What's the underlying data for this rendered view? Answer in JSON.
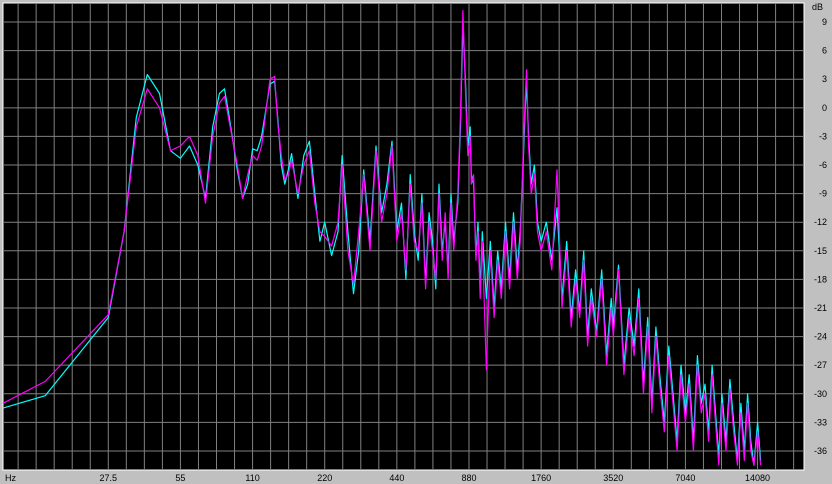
{
  "chart_data": {
    "type": "line",
    "xscale": "log",
    "x_unit": "Hz",
    "y_unit": "dB",
    "xlim": [
      10,
      22000
    ],
    "ylim": [
      -38,
      11
    ],
    "xticks": [
      27.5,
      55,
      110,
      220,
      440,
      880,
      1760,
      3520,
      7040,
      14080
    ],
    "xtick_labels": [
      "27.5",
      "55",
      "110",
      "220",
      "440",
      "880",
      "1760",
      "3520",
      "7040",
      "14080"
    ],
    "yticks": [
      9,
      6,
      3,
      0,
      -3,
      -6,
      -9,
      -12,
      -15,
      -18,
      -21,
      -24,
      -27,
      -30,
      -33,
      -36
    ],
    "ytick_labels": [
      "9",
      "6",
      "3",
      "0",
      "-3",
      "-6",
      "-9",
      "-12",
      "-15",
      "-18",
      "-21",
      "-24",
      "-27",
      "-30",
      "-33",
      "-36"
    ],
    "grid": true,
    "colors": {
      "background": "#000000",
      "grid": "#808080",
      "frame": "#c0c0c0"
    },
    "series": [
      {
        "color": "#00ffff",
        "points": [
          [
            10,
            -31.5
          ],
          [
            15,
            -30.2
          ],
          [
            27.5,
            -22
          ],
          [
            32,
            -13
          ],
          [
            36,
            -1
          ],
          [
            40,
            3.5
          ],
          [
            45,
            1.5
          ],
          [
            50,
            -4.5
          ],
          [
            55,
            -5.3
          ],
          [
            60,
            -4
          ],
          [
            65,
            -6
          ],
          [
            70,
            -9.5
          ],
          [
            75,
            -2
          ],
          [
            80,
            1.5
          ],
          [
            84,
            2
          ],
          [
            88,
            -1
          ],
          [
            95,
            -6.5
          ],
          [
            100,
            -9.5
          ],
          [
            105,
            -8
          ],
          [
            110,
            -4.3
          ],
          [
            115,
            -4.5
          ],
          [
            120,
            -3
          ],
          [
            130,
            2.5
          ],
          [
            136,
            2.8
          ],
          [
            140,
            -1
          ],
          [
            145,
            -6
          ],
          [
            150,
            -8
          ],
          [
            155,
            -6.5
          ],
          [
            160,
            -4.8
          ],
          [
            170,
            -9.5
          ],
          [
            180,
            -5
          ],
          [
            190,
            -3.5
          ],
          [
            200,
            -9
          ],
          [
            210,
            -14
          ],
          [
            220,
            -12
          ],
          [
            235,
            -15.5
          ],
          [
            250,
            -13
          ],
          [
            260,
            -5
          ],
          [
            275,
            -13
          ],
          [
            290,
            -19.5
          ],
          [
            305,
            -15
          ],
          [
            320,
            -6.5
          ],
          [
            340,
            -14
          ],
          [
            360,
            -4
          ],
          [
            380,
            -11
          ],
          [
            400,
            -8
          ],
          [
            420,
            -3.5
          ],
          [
            440,
            -13
          ],
          [
            460,
            -10
          ],
          [
            480,
            -18
          ],
          [
            500,
            -7
          ],
          [
            520,
            -13
          ],
          [
            540,
            -16
          ],
          [
            560,
            -9
          ],
          [
            580,
            -18.5
          ],
          [
            600,
            -11
          ],
          [
            620,
            -14
          ],
          [
            640,
            -19
          ],
          [
            660,
            -8
          ],
          [
            680,
            -15
          ],
          [
            700,
            -12
          ],
          [
            720,
            -17
          ],
          [
            740,
            -9
          ],
          [
            760,
            -14
          ],
          [
            790,
            -10
          ],
          [
            810,
            -2
          ],
          [
            830,
            8.8
          ],
          [
            850,
            3
          ],
          [
            870,
            -4
          ],
          [
            890,
            -2
          ],
          [
            900,
            -7
          ],
          [
            920,
            -8
          ],
          [
            940,
            -15.5
          ],
          [
            960,
            -12
          ],
          [
            980,
            -19
          ],
          [
            1000,
            -13
          ],
          [
            1040,
            -20
          ],
          [
            1080,
            -14
          ],
          [
            1120,
            -21
          ],
          [
            1160,
            -15
          ],
          [
            1200,
            -19
          ],
          [
            1250,
            -12
          ],
          [
            1300,
            -18
          ],
          [
            1350,
            -11
          ],
          [
            1400,
            -17
          ],
          [
            1440,
            -13
          ],
          [
            1480,
            -6
          ],
          [
            1510,
            0
          ],
          [
            1530,
            2.5
          ],
          [
            1560,
            -3
          ],
          [
            1600,
            -8
          ],
          [
            1650,
            -6
          ],
          [
            1700,
            -12
          ],
          [
            1760,
            -14
          ],
          [
            1850,
            -12
          ],
          [
            1950,
            -16
          ],
          [
            2050,
            -10.5
          ],
          [
            2150,
            -20
          ],
          [
            2250,
            -14
          ],
          [
            2350,
            -22
          ],
          [
            2450,
            -17
          ],
          [
            2550,
            -21.5
          ],
          [
            2650,
            -15
          ],
          [
            2750,
            -24
          ],
          [
            2850,
            -19
          ],
          [
            3000,
            -23.5
          ],
          [
            3150,
            -17
          ],
          [
            3300,
            -26
          ],
          [
            3450,
            -20
          ],
          [
            3520,
            -23
          ],
          [
            3700,
            -16.5
          ],
          [
            3900,
            -27
          ],
          [
            4100,
            -21
          ],
          [
            4300,
            -25
          ],
          [
            4500,
            -19
          ],
          [
            4700,
            -29
          ],
          [
            4900,
            -22
          ],
          [
            5100,
            -31
          ],
          [
            5300,
            -23
          ],
          [
            5500,
            -28
          ],
          [
            5750,
            -33
          ],
          [
            6000,
            -25
          ],
          [
            6250,
            -30
          ],
          [
            6500,
            -35
          ],
          [
            6750,
            -27
          ],
          [
            7040,
            -32
          ],
          [
            7300,
            -28
          ],
          [
            7600,
            -35
          ],
          [
            7900,
            -26
          ],
          [
            8200,
            -31
          ],
          [
            8500,
            -29
          ],
          [
            8800,
            -34
          ],
          [
            9100,
            -27
          ],
          [
            9400,
            -32
          ],
          [
            9700,
            -36.5
          ],
          [
            10000,
            -30
          ],
          [
            10400,
            -35
          ],
          [
            10800,
            -28.5
          ],
          [
            11200,
            -33
          ],
          [
            11600,
            -37
          ],
          [
            12000,
            -31
          ],
          [
            12400,
            -36
          ],
          [
            12800,
            -30
          ],
          [
            13200,
            -35
          ],
          [
            13600,
            -37.5
          ],
          [
            14080,
            -33
          ],
          [
            14500,
            -37
          ]
        ]
      },
      {
        "color": "#ff00ff",
        "points": [
          [
            10,
            -31
          ],
          [
            15,
            -28.7
          ],
          [
            27.5,
            -21.7
          ],
          [
            32,
            -13
          ],
          [
            36,
            -2
          ],
          [
            40,
            2
          ],
          [
            45,
            0
          ],
          [
            50,
            -4.5
          ],
          [
            55,
            -4
          ],
          [
            60,
            -3
          ],
          [
            65,
            -5
          ],
          [
            70,
            -10
          ],
          [
            75,
            -3
          ],
          [
            80,
            0.5
          ],
          [
            84,
            1.2
          ],
          [
            88,
            -1.5
          ],
          [
            95,
            -6
          ],
          [
            100,
            -9.5
          ],
          [
            105,
            -7
          ],
          [
            110,
            -5
          ],
          [
            115,
            -5.5
          ],
          [
            120,
            -4
          ],
          [
            130,
            3
          ],
          [
            136,
            3.3
          ],
          [
            140,
            -1.5
          ],
          [
            145,
            -5
          ],
          [
            150,
            -7.5
          ],
          [
            155,
            -7
          ],
          [
            160,
            -5.5
          ],
          [
            170,
            -9
          ],
          [
            180,
            -6
          ],
          [
            190,
            -4.5
          ],
          [
            200,
            -10
          ],
          [
            210,
            -13
          ],
          [
            220,
            -13.5
          ],
          [
            235,
            -14.5
          ],
          [
            250,
            -12
          ],
          [
            260,
            -6
          ],
          [
            275,
            -15
          ],
          [
            290,
            -18.5
          ],
          [
            305,
            -13
          ],
          [
            320,
            -7
          ],
          [
            340,
            -15
          ],
          [
            360,
            -4.5
          ],
          [
            380,
            -12
          ],
          [
            400,
            -9
          ],
          [
            420,
            -4
          ],
          [
            440,
            -14
          ],
          [
            460,
            -11
          ],
          [
            480,
            -17
          ],
          [
            500,
            -8
          ],
          [
            520,
            -14
          ],
          [
            540,
            -15
          ],
          [
            560,
            -10
          ],
          [
            580,
            -19
          ],
          [
            600,
            -12
          ],
          [
            620,
            -15
          ],
          [
            640,
            -18
          ],
          [
            660,
            -9
          ],
          [
            680,
            -16
          ],
          [
            700,
            -11
          ],
          [
            720,
            -18
          ],
          [
            740,
            -10
          ],
          [
            760,
            -15
          ],
          [
            790,
            -9
          ],
          [
            810,
            -1
          ],
          [
            830,
            10.2
          ],
          [
            850,
            2
          ],
          [
            870,
            -5
          ],
          [
            890,
            -3
          ],
          [
            900,
            -8
          ],
          [
            920,
            -7
          ],
          [
            940,
            -16
          ],
          [
            960,
            -13
          ],
          [
            980,
            -20
          ],
          [
            1000,
            -14
          ],
          [
            1040,
            -27.5
          ],
          [
            1080,
            -15
          ],
          [
            1120,
            -22
          ],
          [
            1160,
            -16
          ],
          [
            1200,
            -20
          ],
          [
            1250,
            -13
          ],
          [
            1300,
            -19
          ],
          [
            1350,
            -12
          ],
          [
            1400,
            -18
          ],
          [
            1440,
            -14
          ],
          [
            1480,
            -5
          ],
          [
            1510,
            1
          ],
          [
            1530,
            4
          ],
          [
            1560,
            -4
          ],
          [
            1600,
            -9
          ],
          [
            1650,
            -7
          ],
          [
            1700,
            -13
          ],
          [
            1760,
            -15
          ],
          [
            1850,
            -13
          ],
          [
            1950,
            -17
          ],
          [
            2050,
            -6.5
          ],
          [
            2150,
            -21
          ],
          [
            2250,
            -15
          ],
          [
            2350,
            -23
          ],
          [
            2450,
            -18
          ],
          [
            2550,
            -22
          ],
          [
            2650,
            -16
          ],
          [
            2750,
            -25
          ],
          [
            2850,
            -20
          ],
          [
            3000,
            -24
          ],
          [
            3150,
            -18
          ],
          [
            3300,
            -27
          ],
          [
            3450,
            -21
          ],
          [
            3520,
            -24
          ],
          [
            3700,
            -17
          ],
          [
            3900,
            -28
          ],
          [
            4100,
            -22
          ],
          [
            4300,
            -26
          ],
          [
            4500,
            -20
          ],
          [
            4700,
            -30
          ],
          [
            4900,
            -23
          ],
          [
            5100,
            -32
          ],
          [
            5300,
            -24
          ],
          [
            5500,
            -29
          ],
          [
            5750,
            -34
          ],
          [
            6000,
            -26
          ],
          [
            6250,
            -31
          ],
          [
            6500,
            -36
          ],
          [
            6750,
            -28
          ],
          [
            7040,
            -33
          ],
          [
            7300,
            -29
          ],
          [
            7600,
            -36
          ],
          [
            7900,
            -27
          ],
          [
            8200,
            -32
          ],
          [
            8500,
            -30
          ],
          [
            8800,
            -35
          ],
          [
            9100,
            -28
          ],
          [
            9400,
            -33
          ],
          [
            9700,
            -37.5
          ],
          [
            10000,
            -31
          ],
          [
            10400,
            -36
          ],
          [
            10800,
            -29.5
          ],
          [
            11200,
            -34
          ],
          [
            11600,
            -37.5
          ],
          [
            12000,
            -32
          ],
          [
            12400,
            -37
          ],
          [
            12800,
            -31
          ],
          [
            13200,
            -36
          ],
          [
            13600,
            -37.5
          ],
          [
            14080,
            -34
          ],
          [
            14500,
            -37.5
          ]
        ]
      }
    ]
  }
}
